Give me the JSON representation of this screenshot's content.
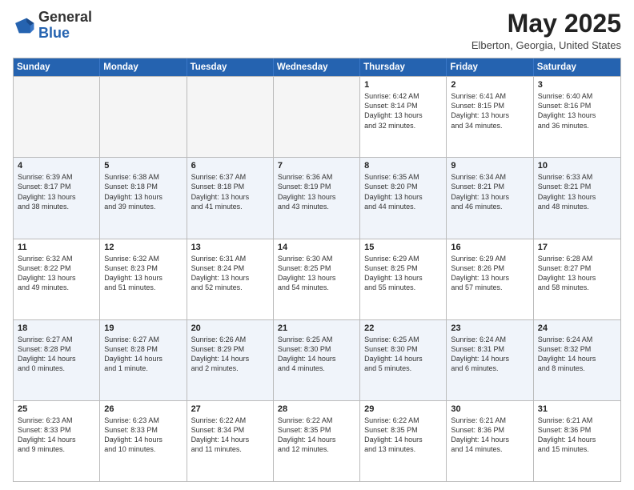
{
  "header": {
    "logo": {
      "general": "General",
      "blue": "Blue"
    },
    "title": "May 2025",
    "location": "Elberton, Georgia, United States"
  },
  "weekdays": [
    "Sunday",
    "Monday",
    "Tuesday",
    "Wednesday",
    "Thursday",
    "Friday",
    "Saturday"
  ],
  "rows": [
    [
      {
        "day": "",
        "info": "",
        "empty": true
      },
      {
        "day": "",
        "info": "",
        "empty": true
      },
      {
        "day": "",
        "info": "",
        "empty": true
      },
      {
        "day": "",
        "info": "",
        "empty": true
      },
      {
        "day": "1",
        "info": "Sunrise: 6:42 AM\nSunset: 8:14 PM\nDaylight: 13 hours\nand 32 minutes."
      },
      {
        "day": "2",
        "info": "Sunrise: 6:41 AM\nSunset: 8:15 PM\nDaylight: 13 hours\nand 34 minutes."
      },
      {
        "day": "3",
        "info": "Sunrise: 6:40 AM\nSunset: 8:16 PM\nDaylight: 13 hours\nand 36 minutes."
      }
    ],
    [
      {
        "day": "4",
        "info": "Sunrise: 6:39 AM\nSunset: 8:17 PM\nDaylight: 13 hours\nand 38 minutes."
      },
      {
        "day": "5",
        "info": "Sunrise: 6:38 AM\nSunset: 8:18 PM\nDaylight: 13 hours\nand 39 minutes."
      },
      {
        "day": "6",
        "info": "Sunrise: 6:37 AM\nSunset: 8:18 PM\nDaylight: 13 hours\nand 41 minutes."
      },
      {
        "day": "7",
        "info": "Sunrise: 6:36 AM\nSunset: 8:19 PM\nDaylight: 13 hours\nand 43 minutes."
      },
      {
        "day": "8",
        "info": "Sunrise: 6:35 AM\nSunset: 8:20 PM\nDaylight: 13 hours\nand 44 minutes."
      },
      {
        "day": "9",
        "info": "Sunrise: 6:34 AM\nSunset: 8:21 PM\nDaylight: 13 hours\nand 46 minutes."
      },
      {
        "day": "10",
        "info": "Sunrise: 6:33 AM\nSunset: 8:21 PM\nDaylight: 13 hours\nand 48 minutes."
      }
    ],
    [
      {
        "day": "11",
        "info": "Sunrise: 6:32 AM\nSunset: 8:22 PM\nDaylight: 13 hours\nand 49 minutes."
      },
      {
        "day": "12",
        "info": "Sunrise: 6:32 AM\nSunset: 8:23 PM\nDaylight: 13 hours\nand 51 minutes."
      },
      {
        "day": "13",
        "info": "Sunrise: 6:31 AM\nSunset: 8:24 PM\nDaylight: 13 hours\nand 52 minutes."
      },
      {
        "day": "14",
        "info": "Sunrise: 6:30 AM\nSunset: 8:25 PM\nDaylight: 13 hours\nand 54 minutes."
      },
      {
        "day": "15",
        "info": "Sunrise: 6:29 AM\nSunset: 8:25 PM\nDaylight: 13 hours\nand 55 minutes."
      },
      {
        "day": "16",
        "info": "Sunrise: 6:29 AM\nSunset: 8:26 PM\nDaylight: 13 hours\nand 57 minutes."
      },
      {
        "day": "17",
        "info": "Sunrise: 6:28 AM\nSunset: 8:27 PM\nDaylight: 13 hours\nand 58 minutes."
      }
    ],
    [
      {
        "day": "18",
        "info": "Sunrise: 6:27 AM\nSunset: 8:28 PM\nDaylight: 14 hours\nand 0 minutes."
      },
      {
        "day": "19",
        "info": "Sunrise: 6:27 AM\nSunset: 8:28 PM\nDaylight: 14 hours\nand 1 minute."
      },
      {
        "day": "20",
        "info": "Sunrise: 6:26 AM\nSunset: 8:29 PM\nDaylight: 14 hours\nand 2 minutes."
      },
      {
        "day": "21",
        "info": "Sunrise: 6:25 AM\nSunset: 8:30 PM\nDaylight: 14 hours\nand 4 minutes."
      },
      {
        "day": "22",
        "info": "Sunrise: 6:25 AM\nSunset: 8:30 PM\nDaylight: 14 hours\nand 5 minutes."
      },
      {
        "day": "23",
        "info": "Sunrise: 6:24 AM\nSunset: 8:31 PM\nDaylight: 14 hours\nand 6 minutes."
      },
      {
        "day": "24",
        "info": "Sunrise: 6:24 AM\nSunset: 8:32 PM\nDaylight: 14 hours\nand 8 minutes."
      }
    ],
    [
      {
        "day": "25",
        "info": "Sunrise: 6:23 AM\nSunset: 8:33 PM\nDaylight: 14 hours\nand 9 minutes."
      },
      {
        "day": "26",
        "info": "Sunrise: 6:23 AM\nSunset: 8:33 PM\nDaylight: 14 hours\nand 10 minutes."
      },
      {
        "day": "27",
        "info": "Sunrise: 6:22 AM\nSunset: 8:34 PM\nDaylight: 14 hours\nand 11 minutes."
      },
      {
        "day": "28",
        "info": "Sunrise: 6:22 AM\nSunset: 8:35 PM\nDaylight: 14 hours\nand 12 minutes."
      },
      {
        "day": "29",
        "info": "Sunrise: 6:22 AM\nSunset: 8:35 PM\nDaylight: 14 hours\nand 13 minutes."
      },
      {
        "day": "30",
        "info": "Sunrise: 6:21 AM\nSunset: 8:36 PM\nDaylight: 14 hours\nand 14 minutes."
      },
      {
        "day": "31",
        "info": "Sunrise: 6:21 AM\nSunset: 8:36 PM\nDaylight: 14 hours\nand 15 minutes."
      }
    ]
  ]
}
